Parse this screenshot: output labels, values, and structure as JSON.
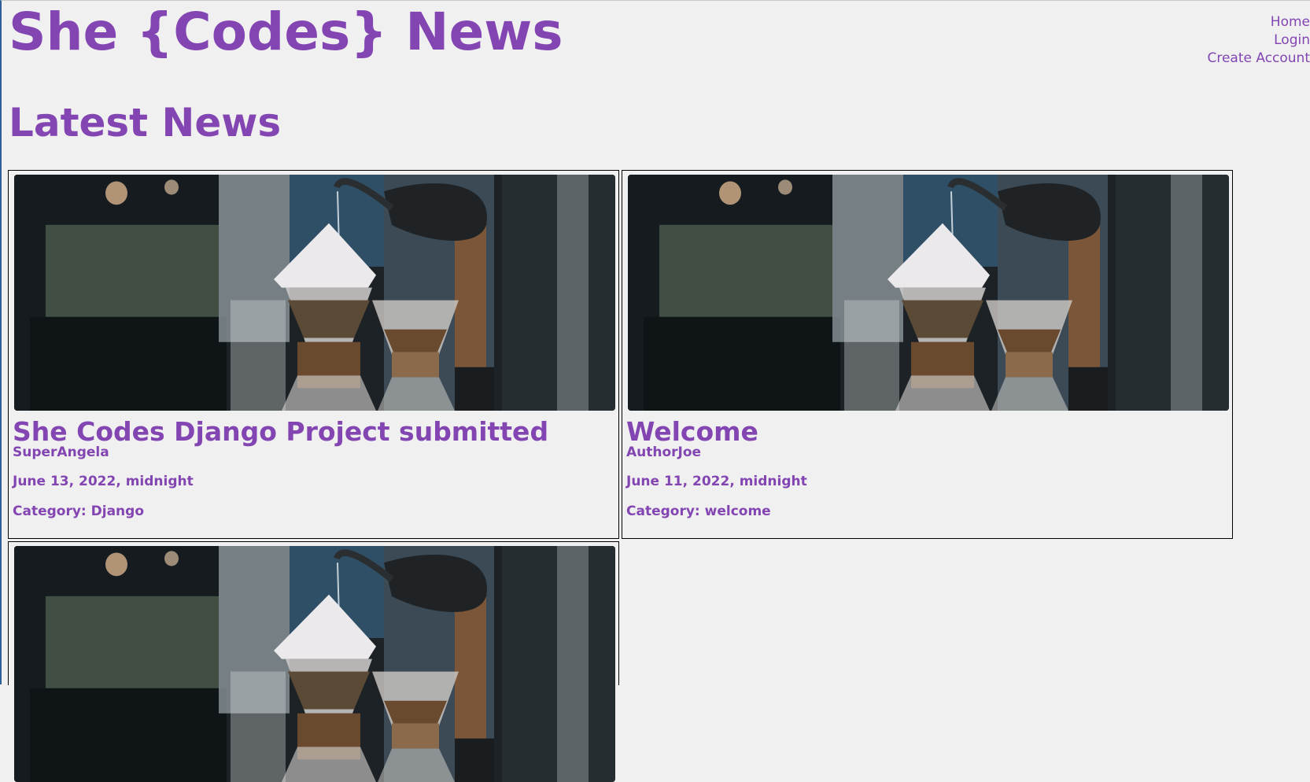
{
  "header": {
    "site_title": "She {Codes} News"
  },
  "nav": {
    "items": [
      {
        "label": "Home"
      },
      {
        "label": "Login"
      },
      {
        "label": "Create Account"
      }
    ]
  },
  "main": {
    "section_title": "Latest News",
    "stories": [
      {
        "image": "pour-over-coffee-photo",
        "title": "She Codes Django Project submitted",
        "author": "SuperAngela",
        "date": "June 13, 2022, midnight",
        "category": "Category: Django"
      },
      {
        "image": "pour-over-coffee-photo",
        "title": "Welcome",
        "author": "AuthorJoe",
        "date": "June 11, 2022, midnight",
        "category": "Category: welcome"
      },
      {
        "image": "pour-over-coffee-photo"
      }
    ]
  },
  "colors": {
    "accent": "#8345b2",
    "background": "#f0f0f0"
  }
}
